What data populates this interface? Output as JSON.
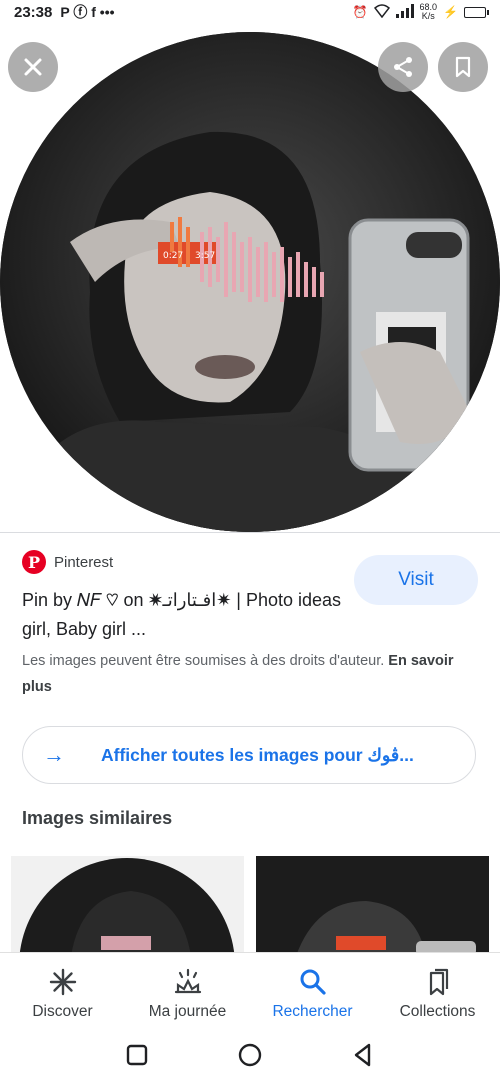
{
  "status_bar": {
    "time": "23:38",
    "app_icons": "P ⓕ f •••",
    "speed_value": "68.0",
    "speed_unit": "K/s"
  },
  "hero": {
    "close_icon": "close-icon",
    "share_icon": "share-icon",
    "bookmark_icon": "bookmark-icon",
    "audio_time_start": "0:27",
    "audio_time_end": "3:57"
  },
  "source": {
    "site_name": "Pinterest",
    "title": "Pin by 𝑁𝐹 ♡ on ✷افـتاراتـ✷ | Photo ideas girl, Baby girl ...",
    "visit_label": "Visit"
  },
  "copyright": {
    "text": "Les images peuvent être soumises à des droits d'auteur.",
    "link": "En savoir plus"
  },
  "show_all": {
    "label": "Afficher toutes les images pour ڤوك..."
  },
  "similar": {
    "title": "Images similaires"
  },
  "bottom_nav": {
    "items": [
      {
        "label": "Discover",
        "icon": "asterisk-icon"
      },
      {
        "label": "Ma journée",
        "icon": "sunrise-icon"
      },
      {
        "label": "Rechercher",
        "icon": "search-icon"
      },
      {
        "label": "Collections",
        "icon": "collections-icon"
      }
    ],
    "active": "Rechercher"
  },
  "colors": {
    "accent": "#1a73e8",
    "pinterest": "#e60023",
    "visit_bg": "#e8f0fe"
  }
}
